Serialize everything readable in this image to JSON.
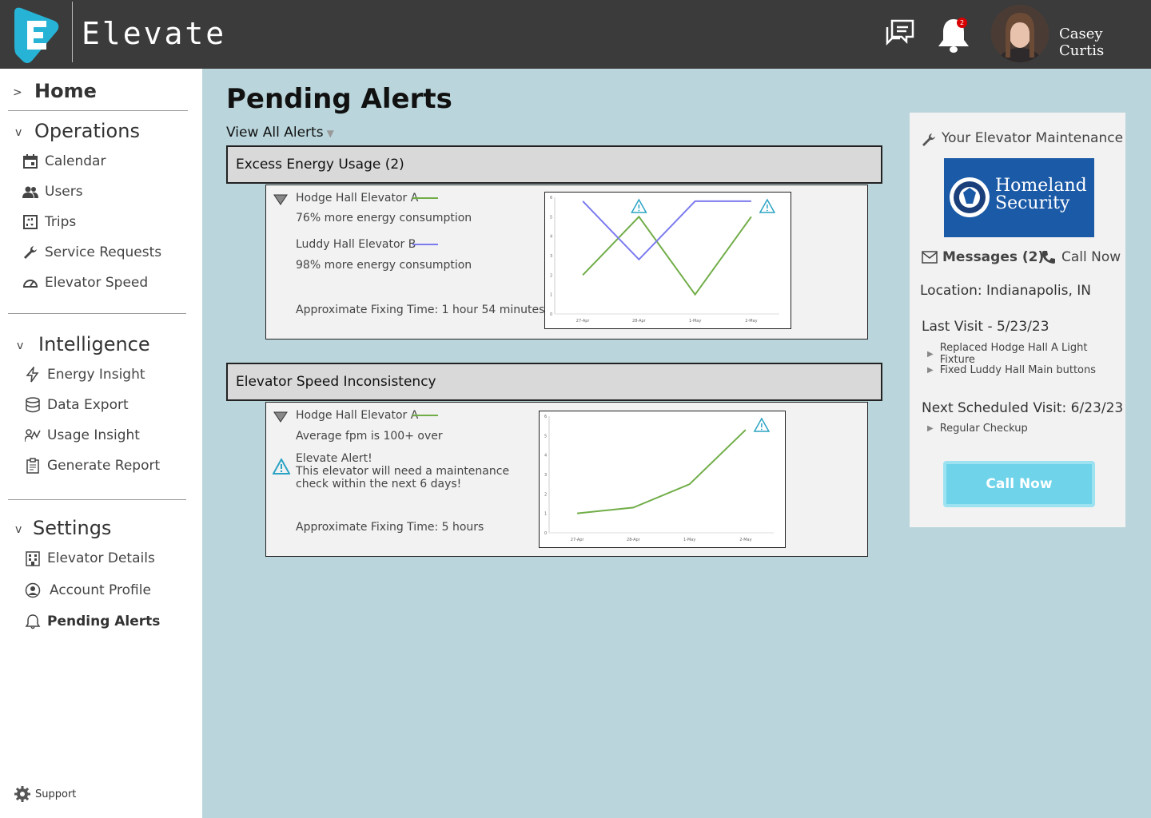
{
  "header": {
    "app_name": "Elevate",
    "logo_letter": "E",
    "notifications_count": "2",
    "user_name": "Casey Curtis"
  },
  "sidebar": {
    "home": "Home",
    "operations": {
      "label": "Operations",
      "items": [
        "Calendar",
        "Users",
        "Trips",
        "Service Requests",
        "Elevator Speed"
      ]
    },
    "intelligence": {
      "label": "Intelligence",
      "items": [
        "Energy Insight",
        "Data Export",
        "Usage Insight",
        "Generate Report"
      ]
    },
    "settings": {
      "label": "Settings",
      "items": [
        "Elevator Details",
        "Account Profile",
        "Pending Alerts"
      ]
    },
    "support": "Support",
    "caret_collapsed": ">",
    "caret_expanded": "v"
  },
  "main": {
    "title": "Pending Alerts",
    "view_all": "View All Alerts",
    "alerts": [
      {
        "heading": "Excess Energy Usage (2)",
        "lines": [
          {
            "name": "Hodge Hall Elevator A",
            "detail": "76% more energy consumption",
            "color": "#70ad47"
          },
          {
            "name": "Luddy Hall Elevator B",
            "detail": "98% more energy consumption",
            "color": "#7b7bef"
          }
        ],
        "fix_time": "Approximate Fixing Time: 1 hour 54 minutes"
      },
      {
        "heading": "Elevator Speed Inconsistency",
        "lines": [
          {
            "name": "Hodge Hall Elevator A",
            "detail": "Average fpm is 100+ over",
            "color": "#70ad47"
          }
        ],
        "warning_title": "Elevate Alert!",
        "warning_text": "This elevator will need a maintenance check within the next 6 days!",
        "fix_time": "Approximate Fixing Time: 5 hours"
      }
    ]
  },
  "card": {
    "title": "Your Elevator Maintenance",
    "company": "Homeland Security",
    "company_line1": "Homeland",
    "company_line2": "Security",
    "messages": "Messages (2)",
    "call_link": "Call Now",
    "location": "Location: Indianapolis, IN",
    "last_visit": "Last Visit - 5/23/23",
    "last_visit_items": [
      "Replaced Hodge Hall A Light Fixture",
      "Fixed Luddy Hall Main buttons"
    ],
    "next_visit": "Next Scheduled Visit: 6/23/23",
    "next_visit_items": [
      "Regular Checkup"
    ],
    "call_button": "Call Now"
  },
  "chart_data": [
    {
      "type": "line",
      "categories": [
        "27-Apr",
        "28-Apr",
        "1-May",
        "2-May"
      ],
      "series": [
        {
          "name": "Hodge Hall Elevator A",
          "values": [
            2,
            5,
            1,
            5
          ],
          "color": "#70ad47"
        },
        {
          "name": "Luddy Hall Elevator B",
          "values": [
            5.8,
            2.8,
            5.8,
            5.8
          ],
          "color": "#7b7bef"
        }
      ],
      "yticks": [
        0,
        1,
        2,
        3,
        4,
        5,
        6
      ],
      "ylim": [
        0,
        6
      ],
      "alert_markers": [
        "28-Apr",
        "2-May"
      ]
    },
    {
      "type": "line",
      "categories": [
        "27-Apr",
        "28-Apr",
        "1-May",
        "2-May"
      ],
      "series": [
        {
          "name": "Hodge Hall Elevator A",
          "values": [
            1,
            1.3,
            2.5,
            5.3
          ],
          "color": "#70ad47"
        }
      ],
      "yticks": [
        0,
        1,
        2,
        3,
        4,
        5,
        6
      ],
      "ylim": [
        0,
        6
      ],
      "alert_markers": [
        "2-May"
      ]
    }
  ]
}
